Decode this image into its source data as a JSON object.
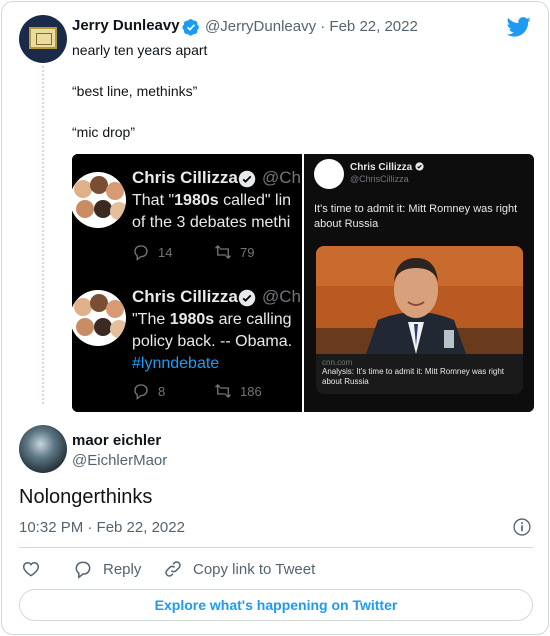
{
  "quote_tweet": {
    "author_name": "Jerry Dunleavy",
    "author_handle": "@JerryDunleavy · Feb 22, 2022",
    "lines": [
      "nearly ten years apart",
      "“best line, methinks”",
      "“mic drop”"
    ]
  },
  "embedded_tweets": [
    {
      "name": "Chris Cillizza",
      "handle": "@Chr",
      "text_lines": [
        "That \"1980s called\" lin",
        "of the 3 debates methi"
      ],
      "replies": "14",
      "retweets": "79"
    },
    {
      "name": "Chris Cillizza",
      "handle": "@Chr",
      "text_lines": [
        "\"The 1980s are calling",
        "policy back. -- Obama.",
        "#lynndebate"
      ],
      "replies": "8",
      "retweets": "186"
    }
  ],
  "screenshot_tweet": {
    "name": "Chris Cillizza",
    "handle": "@ChrisCillizza",
    "text": "It's time to admit it: Mitt Romney was right about Russia",
    "link_domain": "cnn.com",
    "link_title": "Analysis: It's time to admit it: Mitt Romney was right about Russia"
  },
  "main_tweet": {
    "author_name": "maor eichler",
    "author_handle": "@EichlerMaor",
    "text": "Nolongerthinks",
    "timestamp": "10:32 PM · Feb 22, 2022"
  },
  "actions": {
    "reply": "Reply",
    "copy_link": "Copy link to Tweet"
  },
  "explore_label": "Explore what's happening on Twitter",
  "colors": {
    "twitter_blue": "#1d9bf0",
    "text_primary": "#0f1419",
    "text_secondary": "#536471",
    "border": "#cfd9de"
  },
  "icons": [
    "twitter-logo-icon",
    "verified-badge-icon",
    "reply-icon",
    "retweet-icon",
    "info-icon",
    "heart-icon",
    "link-icon"
  ]
}
